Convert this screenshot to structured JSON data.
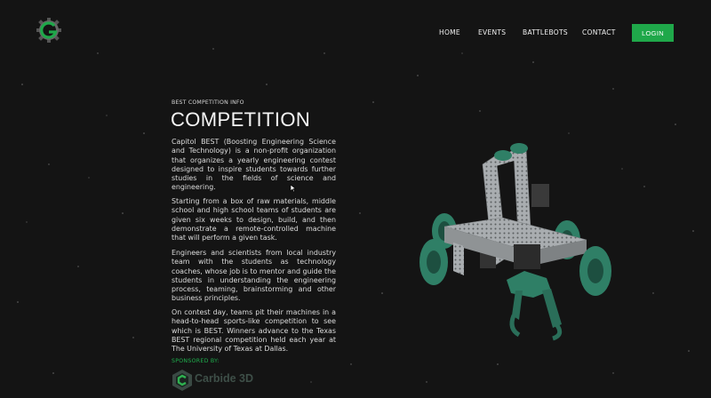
{
  "nav": {
    "links": [
      "HOME",
      "EVENTS",
      "BATTLEBOTS",
      "CONTACT"
    ],
    "login_label": "LOGIN"
  },
  "hero": {
    "eyebrow": "BEST COMPETITION INFO",
    "title": "COMPETITION",
    "paragraphs": [
      "Capitol BEST (Boosting Engineering Science and Technology) is a non-profit organization that organizes a yearly engineering contest designed to inspire students towards further studies in the fields of science and engineering.",
      "Starting from a box of raw materials, middle school and high school teams of students are given six weeks to design, build, and then demonstrate a remote-controlled machine that will perform a given task.",
      "Engineers and scientists from local industry team with the students as technology coaches, whose job is to mentor and guide the students in understanding the engineering process, teaming, brainstorming and other business principles.",
      "On contest day, teams pit their machines in a head-to-head sports-like competition to see which is BEST. Winners advance to the Texas BEST regional competition held each year at The University of Texas at Dallas."
    ]
  },
  "sponsor": {
    "label": "SPONSORED BY:",
    "name": "Carbide 3D"
  },
  "icons": {
    "logo": "gear-g-logo-icon",
    "sponsor_logo": "carbide3d-logo-icon",
    "robot": "robot-render",
    "cursor": "mouse-cursor-icon"
  },
  "colors": {
    "background": "#141414",
    "accent_green": "#1fa84a",
    "robot_green": "#2f7f66",
    "robot_metal": "#a9adb0"
  }
}
